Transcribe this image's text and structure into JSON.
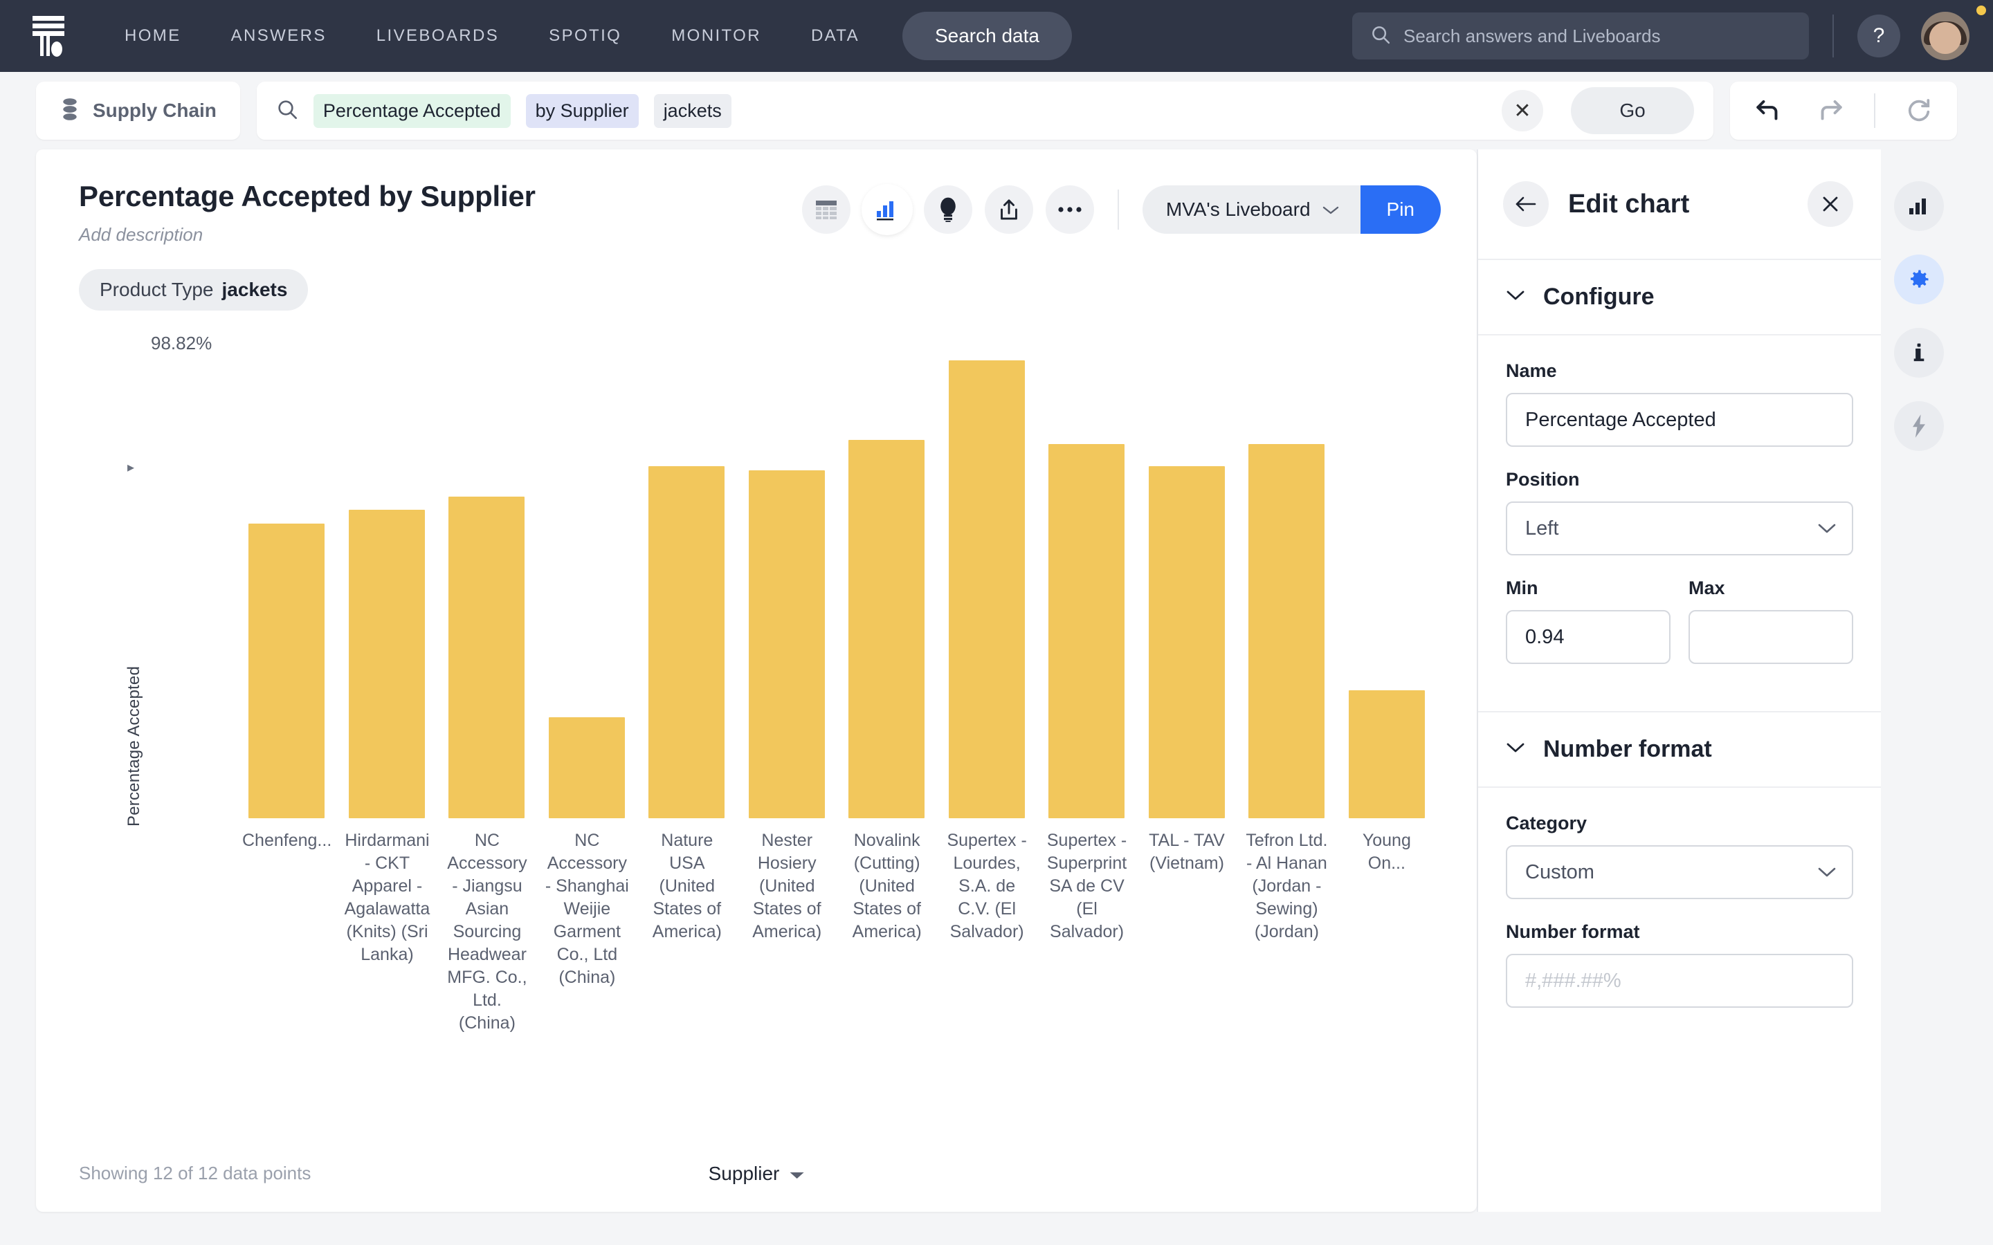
{
  "topnav": {
    "logo_name": "thoughtspot-logo",
    "links": [
      "HOME",
      "ANSWERS",
      "LIVEBOARDS",
      "SPOTIQ",
      "MONITOR",
      "DATA"
    ],
    "search_data_label": "Search data",
    "global_search_placeholder": "Search answers and Liveboards",
    "global_search_value": "",
    "help_label": "?"
  },
  "searchbar": {
    "source_label": "Supply Chain",
    "tokens": [
      {
        "text": "Percentage Accepted",
        "kind": "measure"
      },
      {
        "text": "by Supplier",
        "kind": "attribute"
      },
      {
        "text": "jackets",
        "kind": "filter"
      }
    ],
    "clear_label": "✕",
    "go_label": "Go",
    "undo_name": "undo-icon",
    "redo_name": "redo-icon",
    "reset_name": "reset-icon"
  },
  "viz": {
    "title": "Percentage Accepted by Supplier",
    "description": "Add description",
    "actions": [
      "table-view-icon",
      "chart-view-icon",
      "spotiq-icon",
      "share-icon",
      "more-options-icon"
    ],
    "liveboard_select": "MVA's Liveboard",
    "pin_label": "Pin",
    "filter_pill_label": "Product Type",
    "filter_pill_value": "jackets",
    "footer_count": "Showing 12 of 12 data points",
    "legend_label": "Supplier"
  },
  "chart_data": {
    "type": "bar",
    "title": "Percentage Accepted by Supplier",
    "xlabel": "Supplier",
    "ylabel": "Percentage Accepted",
    "ylim": [
      0.94,
      0.9882
    ],
    "axis_top_tick": "98.82%",
    "grid": false,
    "legend": "Supplier",
    "bar_color": "#f2c75c",
    "value_format": "#,###.##%",
    "categories": [
      "Chenfeng...",
      "Hirdarmani - CKT Apparel - Agalawatta (Knits) (Sri Lanka)",
      "NC Accessory - Jiangsu Asian Sourcing Headwear MFG. Co., Ltd. (China)",
      "NC Accessory - Shanghai Weijie Garment Co., Ltd (China)",
      "Nature USA (United States of America)",
      "Nester Hosiery (United States of America)",
      "Novalink (Cutting) (United States of America)",
      "Supertex - Lourdes, S.A. de C.V. (El Salvador)",
      "Supertex - Superprint SA de CV (El Salvador)",
      "TAL - TAV (Vietnam)",
      "Tefron Ltd. - Al Hanan (Jordan - Sewing) (Jordan)",
      "Young On..."
    ],
    "values": [
      0.9711,
      0.9722,
      0.9733,
      0.9484,
      0.9751,
      0.9747,
      0.9772,
      0.9882,
      0.9768,
      0.9751,
      0.9768,
      0.9506
    ],
    "bar_pixel_heights": [
      335,
      350,
      365,
      115,
      400,
      395,
      430,
      520,
      425,
      400,
      425,
      145
    ]
  },
  "panel": {
    "title": "Edit chart",
    "back_name": "back-arrow-icon",
    "close_name": "close-icon",
    "sections": {
      "configure": {
        "title": "Configure",
        "name_label": "Name",
        "name_value": "Percentage Accepted",
        "position_label": "Position",
        "position_value": "Left",
        "min_label": "Min",
        "min_value": "0.94",
        "max_label": "Max",
        "max_value": "",
        "max_placeholder": ""
      },
      "number_format": {
        "title": "Number format",
        "category_label": "Category",
        "category_value": "Custom",
        "format_label": "Number format",
        "format_value": "",
        "format_placeholder": "#,###.##%"
      }
    }
  },
  "rail": {
    "items": [
      "chart-type-icon",
      "settings-gear-icon",
      "info-icon",
      "lightning-icon"
    ],
    "selected_index": 1
  },
  "colors": {
    "nav_bg": "#2f3545",
    "accent_blue": "#2a6ef5",
    "bar_yellow": "#f2c75c",
    "page_bg": "#f4f5f7"
  }
}
